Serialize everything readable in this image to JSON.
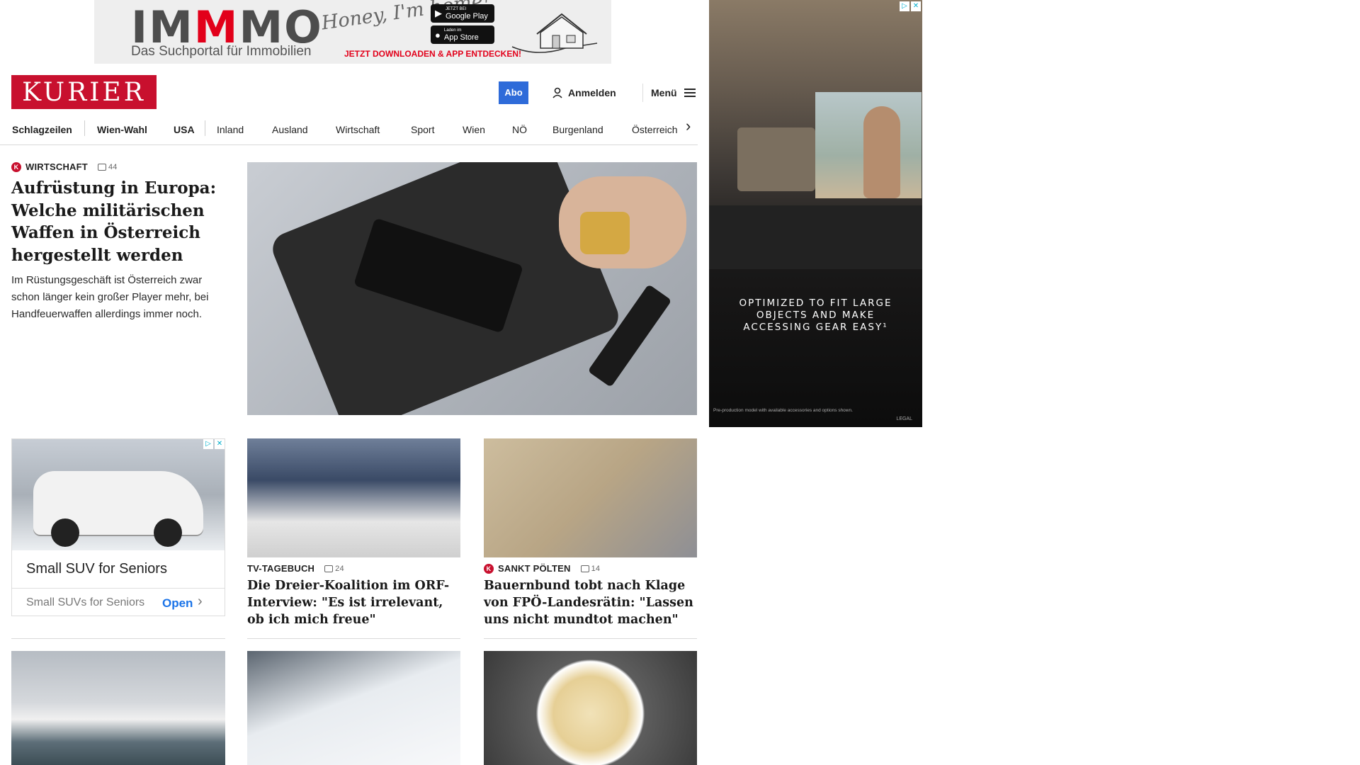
{
  "top_ad": {
    "logo_pre": "IM",
    "logo_red": "M",
    "logo_post": "MO",
    "tagline": "Das Suchportal für Immobilien",
    "handwriting": "Honey, I'm home!",
    "google_play_label": "Google Play",
    "google_play_pre": "JETZT BEI",
    "app_store_label": "App Store",
    "app_store_pre": "Laden im",
    "cta": "JETZT DOWNLOADEN & APP ENTDECKEN!"
  },
  "side_ad": {
    "message": "OPTIMIZED TO FIT LARGE OBJECTS AND MAKE ACCESSING GEAR EASY¹",
    "fine_print": "Pre-production model with available accessories and options shown.",
    "legal": "LEGAL",
    "adchoice_icon": "adchoices-icon",
    "close_icon": "close-icon"
  },
  "header": {
    "logo": "KURIER",
    "abo": "Abo",
    "login": "Anmelden",
    "menu": "Menü"
  },
  "nav": {
    "items": [
      {
        "label": "Schlagzeilen",
        "bold": true
      },
      {
        "label": "Wien-Wahl",
        "bold": true
      },
      {
        "label": "USA",
        "bold": true
      },
      {
        "label": "Inland",
        "bold": false
      },
      {
        "label": "Ausland",
        "bold": false
      },
      {
        "label": "Wirtschaft",
        "bold": false
      },
      {
        "label": "Sport",
        "bold": false
      },
      {
        "label": "Wien",
        "bold": false
      },
      {
        "label": "NÖ",
        "bold": false
      },
      {
        "label": "Burgenland",
        "bold": false
      },
      {
        "label": "Österreich",
        "bold": false
      }
    ],
    "next_icon": "chevron-right-icon"
  },
  "lead": {
    "badge": "K",
    "kicker": "WIRTSCHAFT",
    "comments": "44",
    "title": "Aufrüstung in Europa: Welche militärischen Waffen in Österreich hergestellt werden",
    "teaser": "Im Rüstungsgeschäft ist Österreich zwar schon länger kein großer Player mehr, bei Handfeuerwaffen allerdings immer noch."
  },
  "ad_card": {
    "headline": "Small SUV for Seniors",
    "footer": "Small SUVs for Seniors",
    "open": "Open"
  },
  "cards": [
    {
      "kicker": "TV-TAGEBUCH",
      "comments": "24",
      "title": "Die Dreier-Koalition im ORF-Interview: \"Es ist irrelevant, ob ich mich freue\""
    },
    {
      "badge": "K",
      "kicker": "SANKT PÖLTEN",
      "comments": "14",
      "title": "Bauernbund tobt nach Klage von FPÖ-Landesrätin: \"Lassen uns nicht mundtot machen\""
    }
  ]
}
